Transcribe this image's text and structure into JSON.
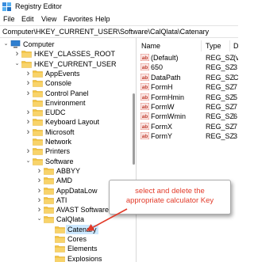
{
  "window": {
    "title": "Registry Editor"
  },
  "menu": [
    "File",
    "Edit",
    "View",
    "Favorites",
    "Help"
  ],
  "address": "Computer\\HKEY_CURRENT_USER\\Software\\CalQlata\\Catenary",
  "tree": [
    {
      "label": "Computer",
      "chevron": "v",
      "kind": "computer"
    },
    {
      "label": "HKEY_CLASSES_ROOT",
      "chevron": ">",
      "kind": "folder"
    },
    {
      "label": "HKEY_CURRENT_USER",
      "chevron": "v",
      "kind": "folder"
    },
    {
      "label": "AppEvents",
      "chevron": ">",
      "kind": "folder"
    },
    {
      "label": "Console",
      "chevron": ">",
      "kind": "folder"
    },
    {
      "label": "Control Panel",
      "chevron": ">",
      "kind": "folder"
    },
    {
      "label": "Environment",
      "chevron": "",
      "kind": "folder"
    },
    {
      "label": "EUDC",
      "chevron": ">",
      "kind": "folder"
    },
    {
      "label": "Keyboard Layout",
      "chevron": ">",
      "kind": "folder"
    },
    {
      "label": "Microsoft",
      "chevron": ">",
      "kind": "folder"
    },
    {
      "label": "Network",
      "chevron": "",
      "kind": "folder"
    },
    {
      "label": "Printers",
      "chevron": ">",
      "kind": "folder"
    },
    {
      "label": "Software",
      "chevron": "v",
      "kind": "folder"
    },
    {
      "label": "ABBYY",
      "chevron": ">",
      "kind": "folder"
    },
    {
      "label": "AMD",
      "chevron": ">",
      "kind": "folder"
    },
    {
      "label": "AppDataLow",
      "chevron": ">",
      "kind": "folder"
    },
    {
      "label": "ATI",
      "chevron": ">",
      "kind": "folder"
    },
    {
      "label": "AVAST Software",
      "chevron": ">",
      "kind": "folder"
    },
    {
      "label": "CalQlata",
      "chevron": "v",
      "kind": "folder"
    },
    {
      "label": "Catenary",
      "chevron": "",
      "kind": "folder",
      "selected": true
    },
    {
      "label": "Cores",
      "chevron": "",
      "kind": "folder"
    },
    {
      "label": "Elements",
      "chevron": "",
      "kind": "folder"
    },
    {
      "label": "Explosions",
      "chevron": "",
      "kind": "folder"
    }
  ],
  "list": {
    "columns": [
      "Name",
      "Type",
      "D"
    ],
    "rows": [
      {
        "name": "(Default)",
        "type": "REG_SZ",
        "data": "(v"
      },
      {
        "name": "650",
        "type": "REG_SZ",
        "data": "3"
      },
      {
        "name": "DataPath",
        "type": "REG_SZ",
        "data": "C"
      },
      {
        "name": "FormH",
        "type": "REG_SZ",
        "data": "7"
      },
      {
        "name": "FormHmin",
        "type": "REG_SZ",
        "data": "5"
      },
      {
        "name": "FormW",
        "type": "REG_SZ",
        "data": "7"
      },
      {
        "name": "FormWmin",
        "type": "REG_SZ",
        "data": "6"
      },
      {
        "name": "FormX",
        "type": "REG_SZ",
        "data": "7"
      },
      {
        "name": "FormY",
        "type": "REG_SZ",
        "data": "3"
      }
    ]
  },
  "callout": {
    "line1": "select and delete the",
    "line2": "appropriate calculator Key"
  },
  "colors": {
    "callout_text": "#e23b2a",
    "selection": "#cce8ff",
    "folder": "#f3c342",
    "arrow": "#e23b2a"
  }
}
